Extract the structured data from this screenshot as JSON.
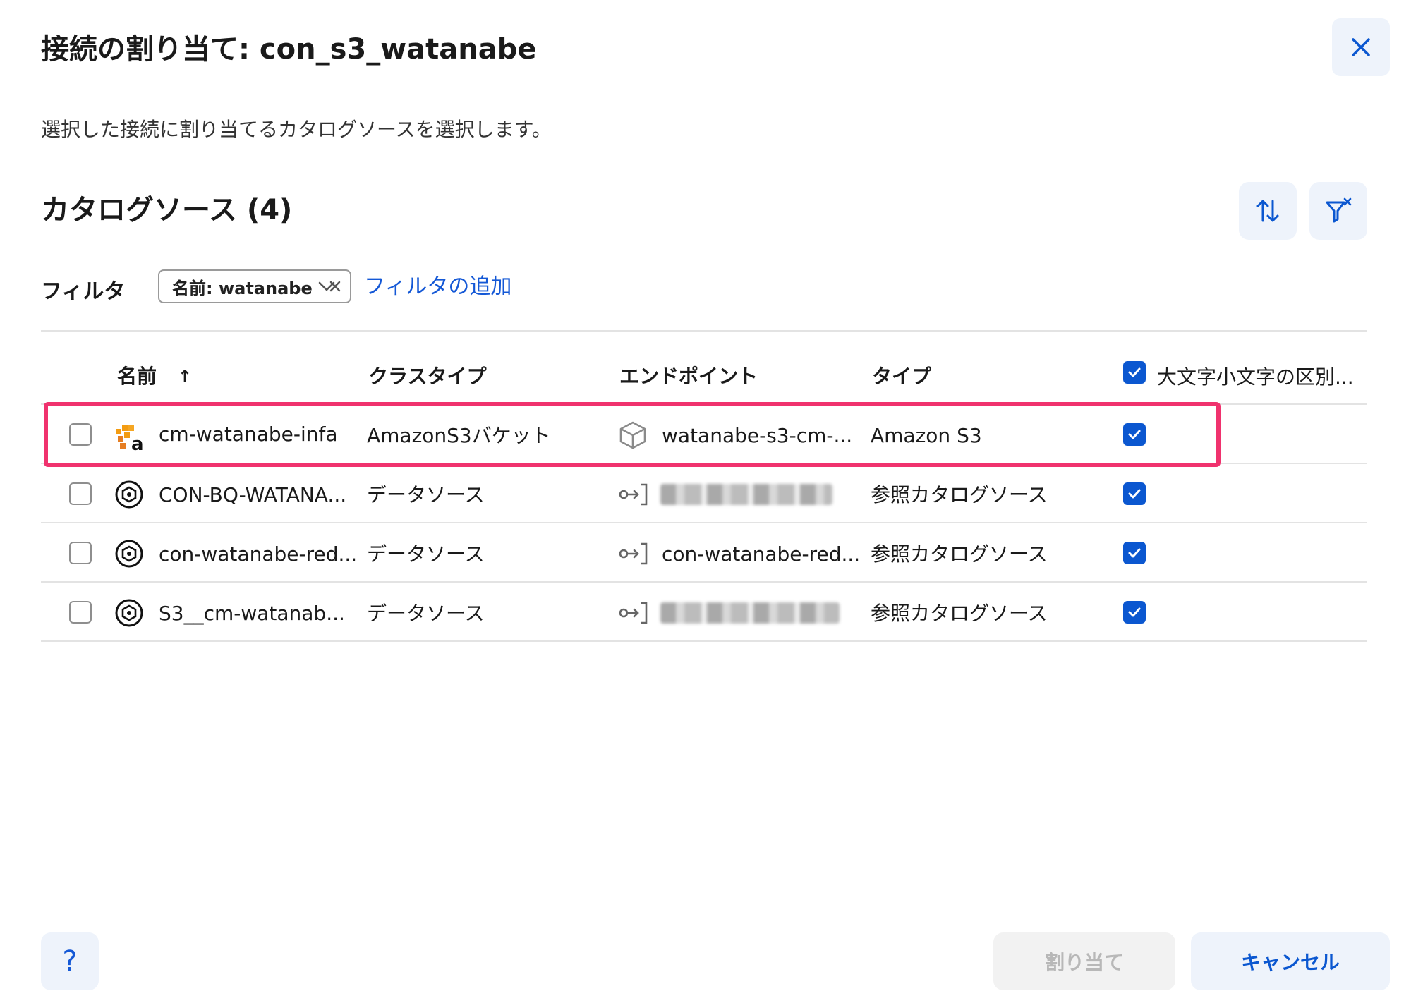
{
  "dialog": {
    "title": "接続の割り当て: con_s3_watanabe",
    "description": "選択した接続に割り当てるカタログソースを選択します。"
  },
  "section": {
    "title": "カタログソース (4)"
  },
  "filter": {
    "label": "フィルタ",
    "chip_label": "名前: watanabe",
    "add_label": "フィルタの追加"
  },
  "table": {
    "columns": {
      "name": "名前",
      "name_sort": "↑",
      "class_type": "クラスタイプ",
      "endpoint": "エンドポイント",
      "type": "タイプ",
      "case_sensitive": "大文字小文字の区別..."
    },
    "rows": [
      {
        "name": "cm-watanabe-infa",
        "icon": "amazon-s3-icon",
        "class_type": "AmazonS3バケット",
        "endpoint_icon": "cube-icon",
        "endpoint": "watanabe-s3-cm-...",
        "type": "Amazon S3",
        "case_sensitive": true,
        "selected": false
      },
      {
        "name": "CON-BQ-WATANA...",
        "icon": "reference-source-icon",
        "class_type": "データソース",
        "endpoint_icon": "connection-icon",
        "endpoint": "",
        "endpoint_redacted": true,
        "type": "参照カタログソース",
        "case_sensitive": true,
        "selected": false
      },
      {
        "name": "con-watanabe-red...",
        "icon": "reference-source-icon",
        "class_type": "データソース",
        "endpoint_icon": "connection-icon",
        "endpoint": "con-watanabe-red...",
        "type": "参照カタログソース",
        "case_sensitive": true,
        "selected": false
      },
      {
        "name": "S3__cm-watanab...",
        "icon": "reference-source-icon",
        "class_type": "データソース",
        "endpoint_icon": "connection-icon",
        "endpoint": "",
        "endpoint_redacted": true,
        "type": "参照カタログソース",
        "case_sensitive": true,
        "selected": false
      }
    ]
  },
  "footer": {
    "help_label": "?",
    "assign_label": "割り当て",
    "cancel_label": "キャンセル"
  },
  "colors": {
    "accent": "#0b57d0",
    "link": "#1458d6",
    "highlight": "#f0326e",
    "button_bg": "#eef3fb"
  }
}
